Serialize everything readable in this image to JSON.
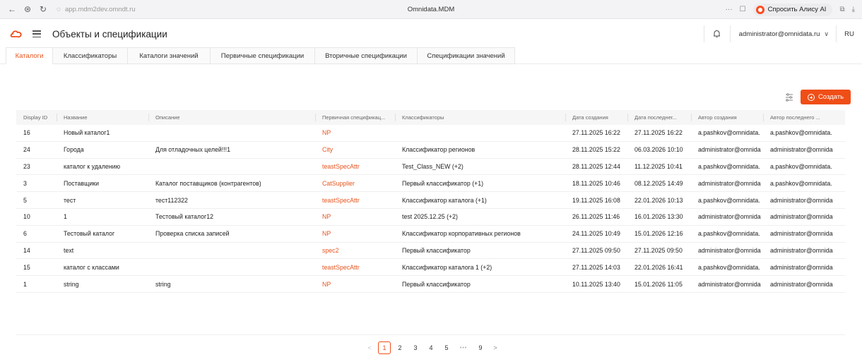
{
  "browser": {
    "url": "app.mdm2dev.omndt.ru",
    "title": "Omnidata.MDM",
    "more": "···",
    "alice_label": "Спросить Алису AI"
  },
  "header": {
    "title": "Объекты и спецификации",
    "user": "administrator@omnidata.ru",
    "language": "RU"
  },
  "tabs": [
    {
      "label": "Каталоги",
      "active": true
    },
    {
      "label": "Классификаторы",
      "active": false
    },
    {
      "label": "Каталоги значений",
      "active": false
    },
    {
      "label": "Первичные спецификации",
      "active": false
    },
    {
      "label": "Вторичные спецификации",
      "active": false
    },
    {
      "label": "Спецификации значений",
      "active": false
    }
  ],
  "toolbar": {
    "create_label": "Создать",
    "accent": "#ef4e17"
  },
  "table": {
    "columns": [
      "Display ID",
      "Название",
      "Описание",
      "Первичная спецификац...",
      "Классификаторы",
      "Дата создания",
      "Дата последнег...",
      "Автор создания",
      "Автор последнего ..."
    ],
    "rows": [
      [
        "16",
        "Новый каталог1",
        "",
        "NP",
        "",
        "27.11.2025 16:22",
        "27.11.2025 16:22",
        "a.pashkov@omnidata.",
        "a.pashkov@omnidata."
      ],
      [
        "24",
        "Города",
        "Для отладочных целей!!!1",
        "City",
        "Классификатор регионов",
        "28.11.2025 15:22",
        "06.03.2026 10:10",
        "administrator@omnida",
        "administrator@omnida"
      ],
      [
        "23",
        "каталог к удалению",
        "",
        "teastSpecAttr",
        "Test_Class_NEW (+2)",
        "28.11.2025 12:44",
        "11.12.2025 10:41",
        "a.pashkov@omnidata.",
        "a.pashkov@omnidata."
      ],
      [
        "3",
        "Поставщики",
        "Каталог поставщиков (контрагентов)",
        "CatSupplier",
        "Первый классификатор (+1)",
        "18.11.2025 10:46",
        "08.12.2025 14:49",
        "administrator@omnida",
        "a.pashkov@omnidata."
      ],
      [
        "5",
        "тест",
        "тест112322",
        "teastSpecAttr",
        "Классификатор каталога (+1)",
        "19.11.2025 16:08",
        "22.01.2026 10:13",
        "a.pashkov@omnidata.",
        "administrator@omnida"
      ],
      [
        "10",
        "1",
        "Тестовый каталог12",
        "NP",
        "test 2025.12.25 (+2)",
        "26.11.2025 11:46",
        "16.01.2026 13:30",
        "administrator@omnida",
        "administrator@omnida"
      ],
      [
        "6",
        "Тестовый каталог",
        "Проверка списка записей",
        "NP",
        "Классификатор корпоративных регионов",
        "24.11.2025 10:49",
        "15.01.2026 12:16",
        "a.pashkov@omnidata.",
        "administrator@omnida"
      ],
      [
        "14",
        "text",
        "",
        "spec2",
        "Первый классификатор",
        "27.11.2025 09:50",
        "27.11.2025 09:50",
        "administrator@omnida",
        "administrator@omnida"
      ],
      [
        "15",
        "каталог с классами",
        "",
        "teastSpecAttr",
        "Классификатор каталога 1 (+2)",
        "27.11.2025 14:03",
        "22.01.2026 16:41",
        "a.pashkov@omnidata.",
        "administrator@omnida"
      ],
      [
        "1",
        "string",
        "string",
        "NP",
        "Первый классификатор",
        "10.11.2025 13:40",
        "15.01.2026 11:05",
        "administrator@omnida",
        "administrator@omnida"
      ]
    ]
  },
  "pagination": {
    "pages": [
      "1",
      "2",
      "3",
      "4",
      "5",
      "•••",
      "9"
    ],
    "current": "1",
    "prev": "<",
    "next": ">"
  }
}
